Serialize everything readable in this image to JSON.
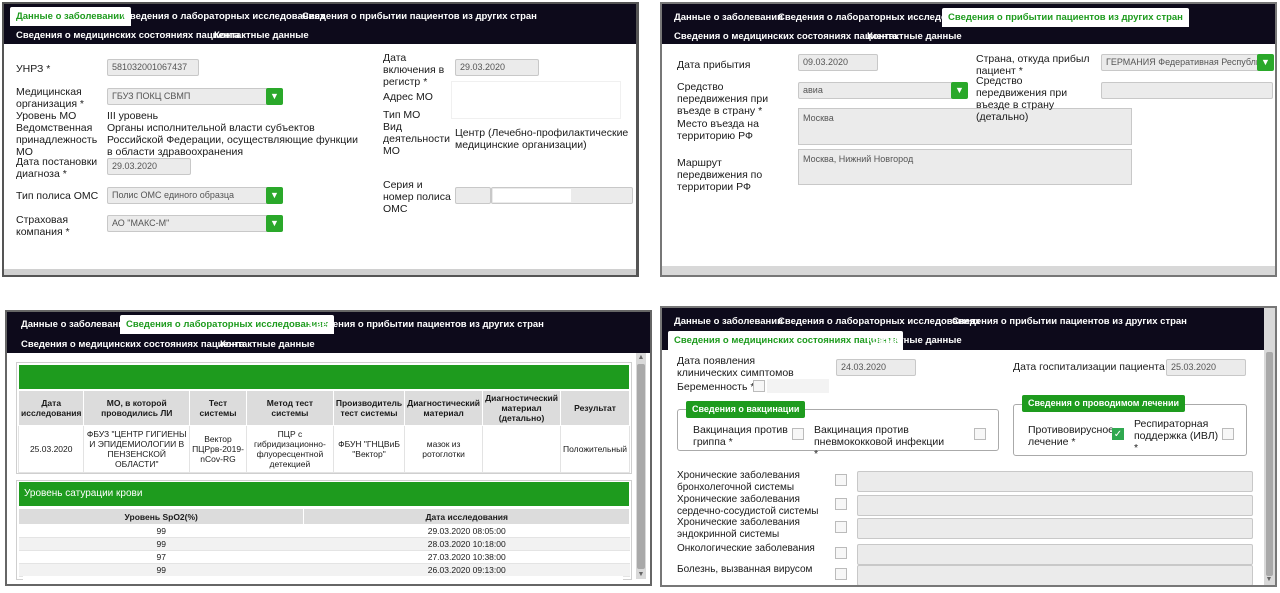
{
  "nav": {
    "tab_disease": "Данные о заболевании",
    "tab_lab": "Сведения о лабораторных исследованиях",
    "tab_arrival": "Сведения о прибытии пациентов из других стран",
    "tab_medical": "Сведения о медицинских состояниях пациента",
    "tab_contacts": "Контактные данные"
  },
  "p1": {
    "unrz_label": "УНРЗ *",
    "unrz_value": "581032001067437",
    "med_org_label": "Медицинская организация *",
    "med_org_value": "ГБУЗ ПОКЦ СВМП",
    "level_label": "Уровень МО",
    "level_value": "III уровень",
    "dept_label": "Ведомственная принадлежность МО",
    "dept_value": "Органы исполнительной власти субъектов Российской Федерации, осуществляющие функции в области здравоохранения",
    "diag_date_label": "Дата постановки диагноза *",
    "diag_date_value": "29.03.2020",
    "policy_type_label": "Тип полиса ОМС",
    "policy_type_value": "Полис ОМС единого образца",
    "insurer_label": "Страховая компания *",
    "insurer_value": "АО \"МАКС-М\"",
    "reg_date_label": "Дата включения в регистр *",
    "reg_date_value": "29.03.2020",
    "address_label": "Адрес МО",
    "type_label": "Тип МО",
    "activity_label": "Вид деятельности МО",
    "activity_value": "Центр (Лечебно-профилактические медицинские организации)",
    "policy_num_label": "Серия и номер полиса ОМС"
  },
  "p2": {
    "arrival_date_label": "Дата прибытия",
    "arrival_date_value": "09.03.2020",
    "transport_label": "Средство передвижения при въезде в страну *",
    "transport_value": "авиа",
    "entry_place_label": "Место въезда на территорию РФ",
    "entry_place_value": "Москва",
    "route_label": "Маршрут передвижения по территории РФ",
    "route_value": "Москва, Нижний Новгород",
    "country_label": "Страна, откуда прибыл пациент *",
    "country_value": "ГЕРМАНИЯ Федеративная Республика Ге",
    "transport_detail_label": "Средство передвижения при въезде в страну (детально)"
  },
  "p3": {
    "lab_headers": [
      "Дата исследования",
      "МО, в которой проводились ЛИ",
      "Тест системы",
      "Метод тест системы",
      "Производитель тест системы",
      "Диагностический материал",
      "Диагностический материал (детально)",
      "Результат"
    ],
    "lab_row": [
      "25.03.2020",
      "ФБУЗ \"ЦЕНТР ГИГИЕНЫ И ЭПИДЕМИОЛОГИИ В ПЕНЗЕНСКОЙ ОБЛАСТИ\"",
      "Вектор ПЦРрв-2019-nCov-RG",
      "ПЦР с гибридизационно-флуоресцентной детекцией",
      "ФБУН \"ГНЦВиБ \"Вектор\"",
      "мазок из ротоглотки",
      "",
      "Положительный"
    ],
    "sat_title": "Уровень сатурации крови",
    "sat_headers": [
      "Уровень SpO2(%)",
      "Дата исследования"
    ],
    "sat_rows": [
      [
        "99",
        "29.03.2020 08:05:00"
      ],
      [
        "99",
        "28.03.2020 10:18:00"
      ],
      [
        "97",
        "27.03.2020 10:38:00"
      ],
      [
        "99",
        "26.03.2020 09:13:00"
      ]
    ]
  },
  "p4": {
    "symptoms_label": "Дата появления клинических симптомов",
    "symptoms_value": "24.03.2020",
    "hosp_label": "Дата госпитализации пациента",
    "hosp_value": "25.03.2020",
    "pregnancy_label": "Беременность *",
    "vacc_title": "Сведения о вакцинации",
    "flu_label": "Вакцинация против гриппа *",
    "pneumo_label": "Вакцинация против пневмококковой инфекции *",
    "treat_title": "Сведения о проводимом лечении",
    "antiviral_label": "Противовирусное лечение *",
    "ivl_label": "Респираторная поддержка (ИВЛ) *",
    "chronic": [
      "Хронические заболевания бронхолегочной системы",
      "Хронические заболевания сердечно-сосудистой системы",
      "Хронические заболевания эндокринной системы",
      "Онкологические заболевания",
      "Болезнь, вызванная вирусом"
    ]
  }
}
